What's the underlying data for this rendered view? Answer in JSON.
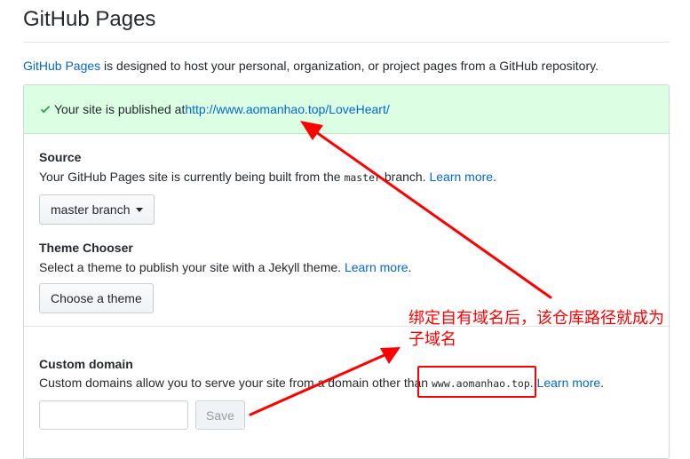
{
  "header": {
    "title": "GitHub Pages"
  },
  "intro": {
    "link": "GitHub Pages",
    "text": " is designed to host your personal, organization, or project pages from a GitHub repository."
  },
  "flash": {
    "text": "Your site is published at ",
    "url": "http://www.aomanhao.top/LoveHeart/"
  },
  "source": {
    "label": "Source",
    "desc_before": "Your GitHub Pages site is currently being built from the ",
    "branch_code": "master",
    "desc_after": " branch. ",
    "learn_more": "Learn more",
    "period": ".",
    "button": "master branch"
  },
  "theme": {
    "label": "Theme Chooser",
    "desc": "Select a theme to publish your site with a Jekyll theme. ",
    "learn_more": "Learn more",
    "period": ".",
    "button": "Choose a theme"
  },
  "custom_domain": {
    "label": "Custom domain",
    "desc_before": "Custom domains allow you to serve your site from a domain other than ",
    "domain_code": "www.aomanhao.top",
    "desc_after": ". ",
    "learn_more": "Learn more",
    "period": ".",
    "input_value": "",
    "save_label": "Save"
  },
  "annotation": {
    "text": "绑定自有域名后，该仓库路径就成为子域名",
    "color": "#ff0000"
  },
  "colors": {
    "link": "#0366d6",
    "success_bg": "#dcffe4",
    "success_icon": "#28a745"
  }
}
